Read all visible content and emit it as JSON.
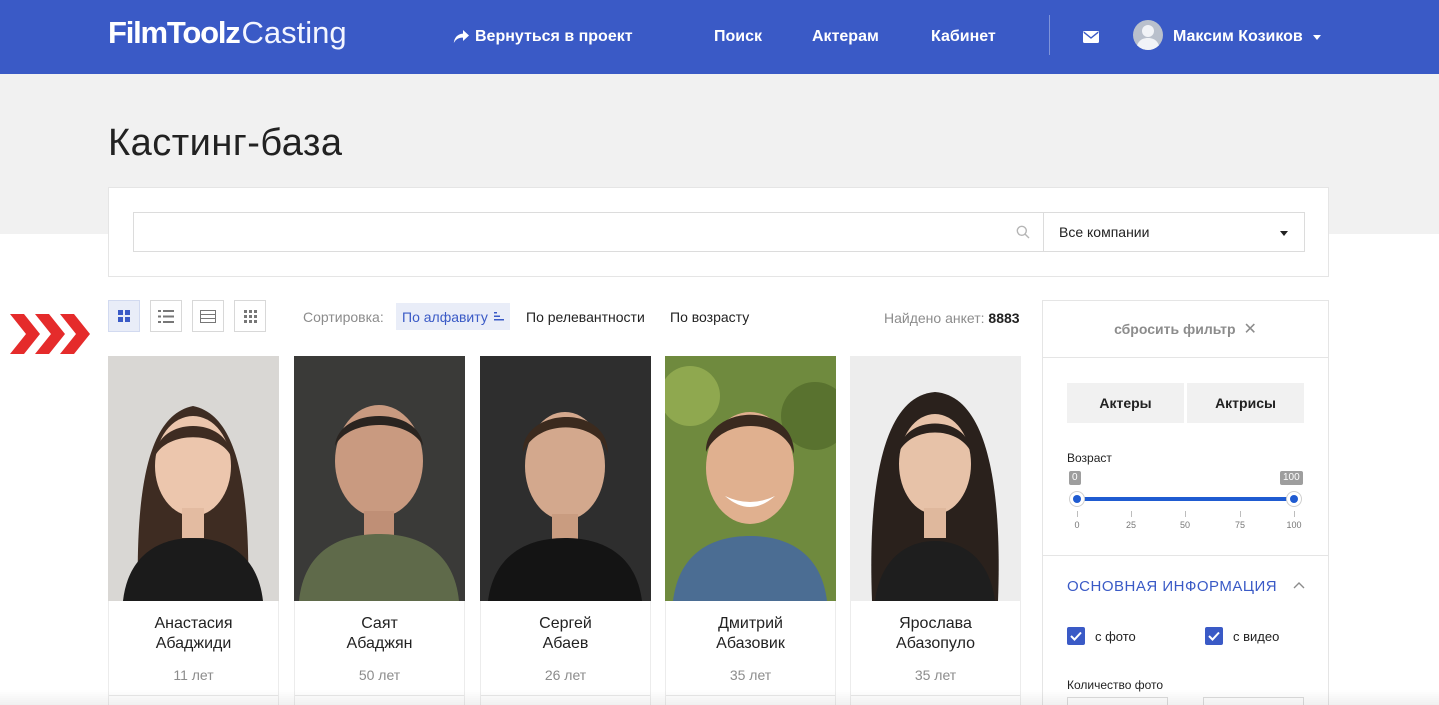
{
  "header": {
    "logo_bold": "FilmToolz",
    "logo_light": "Casting",
    "back_to_project": "Вернуться в проект",
    "nav": [
      "Поиск",
      "Актерам",
      "Кабинет"
    ],
    "user_name": "Максим Козиков"
  },
  "page": {
    "title": "Кастинг-база"
  },
  "search": {
    "query": "",
    "placeholder": "",
    "company_selected": "Все компании"
  },
  "toolbar": {
    "sort_label": "Сортировка:",
    "sort_options": [
      "По алфавиту",
      "По релевантности",
      "По возрасту"
    ],
    "found_label": "Найдено анкет:",
    "found_count": "8883"
  },
  "cards": [
    {
      "first": "Анастасия",
      "last": "Абаджиди",
      "age": "11 лет"
    },
    {
      "first": "Саят",
      "last": "Абаджян",
      "age": "50 лет"
    },
    {
      "first": "Сергей",
      "last": "Абаев",
      "age": "26 лет"
    },
    {
      "first": "Дмитрий",
      "last": "Абазовик",
      "age": "35 лет"
    },
    {
      "first": "Ярослава",
      "last": "Абазопуло",
      "age": "35 лет"
    }
  ],
  "filter": {
    "reset": "сбросить фильтр",
    "gender": [
      "Актеры",
      "Актрисы"
    ],
    "age_label": "Возраст",
    "age_min": "0",
    "age_max": "100",
    "age_ticks": [
      "0",
      "25",
      "50",
      "75",
      "100"
    ],
    "section_title": "ОСНОВНАЯ ИНФОРМАЦИЯ",
    "with_photo": "с фото",
    "with_video": "с видео",
    "photo_count_label": "Количество фото"
  },
  "colors": {
    "brand": "#3a5ac6",
    "accent_red": "#e52b2b",
    "slider": "#1f5bd1"
  }
}
